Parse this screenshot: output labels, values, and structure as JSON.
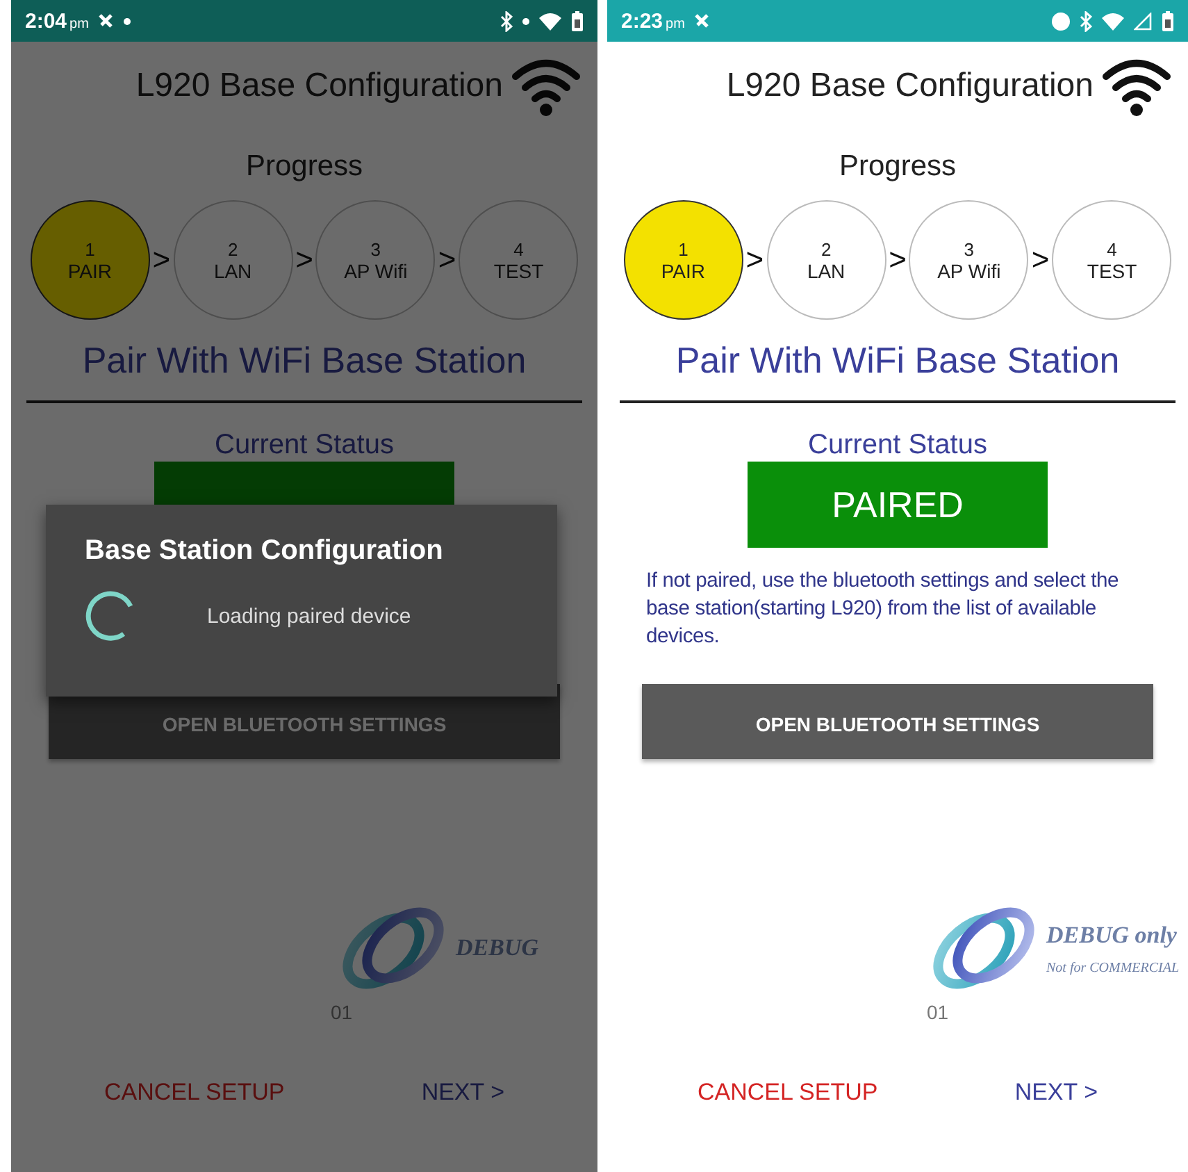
{
  "screens": [
    {
      "status_bar": {
        "time": "2:04",
        "period": "pm",
        "color": "#0e5e57",
        "icons": [
          {
            "kind": "mute"
          },
          {
            "kind": "dot"
          },
          {
            "kind": "spacer"
          },
          {
            "kind": "bluetooth"
          },
          {
            "kind": "dot"
          },
          {
            "kind": "wifi"
          },
          {
            "kind": "battery"
          }
        ]
      },
      "title": "L920 Base Configuration",
      "progress_label": "Progress",
      "steps": [
        {
          "number": "1",
          "label": "PAIR",
          "selected": true
        },
        {
          "arrow": ">",
          "number": "2",
          "label": "LAN",
          "selected": false
        },
        {
          "arrow": ">",
          "number": "3",
          "label": "AP Wifi",
          "selected": false
        },
        {
          "arrow": ">",
          "number": "4",
          "label": "TEST",
          "selected": false
        }
      ],
      "heading": "Pair With WiFi Base Station",
      "status_label": "Current Status",
      "button": "OPEN BLUETOOTH SETTINGS",
      "logo": {
        "title": "DEBUG"
      },
      "version": "01",
      "cancel": "CANCEL SETUP",
      "next": "NEXT >",
      "dialog": {
        "title": "Base Station Configuration",
        "message": "Loading paired device"
      }
    },
    {
      "status_bar": {
        "time": "2:23",
        "period": "pm",
        "color": "#1ba6a8",
        "icons": [
          {
            "kind": "mute"
          },
          {
            "kind": "spacer"
          },
          {
            "kind": "record"
          },
          {
            "kind": "bluetooth"
          },
          {
            "kind": "wifi"
          },
          {
            "kind": "signal"
          },
          {
            "kind": "battery"
          }
        ]
      },
      "title": "L920 Base Configuration",
      "progress_label": "Progress",
      "steps": [
        {
          "number": "1",
          "label": "PAIR",
          "selected": true
        },
        {
          "arrow": ">",
          "number": "2",
          "label": "LAN",
          "selected": false
        },
        {
          "arrow": ">",
          "number": "3",
          "label": "AP Wifi",
          "selected": false
        },
        {
          "arrow": ">",
          "number": "4",
          "label": "TEST",
          "selected": false
        }
      ],
      "heading": "Pair With WiFi Base Station",
      "status_label": "Current Status",
      "status": "PAIRED",
      "instructions": "If not paired, use the bluetooth settings and select the base station(starting L920) from the list of available devices.",
      "button": "OPEN BLUETOOTH SETTINGS",
      "logo": {
        "title": "DEBUG only",
        "subtitle": "Not for COMMERCIAL"
      },
      "version": "01",
      "cancel": "CANCEL SETUP",
      "next": "NEXT >"
    }
  ]
}
